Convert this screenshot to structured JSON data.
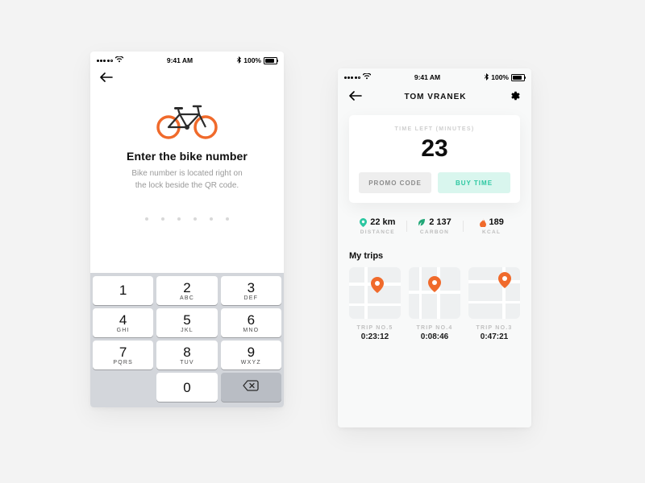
{
  "statusbar": {
    "time": "9:41 AM",
    "battery": "100%"
  },
  "screenA": {
    "title": "Enter the bike number",
    "subtitle_line1": "Bike number is located right on",
    "subtitle_line2": "the lock beside the QR code.",
    "code_length": 6,
    "keypad": {
      "r1": [
        {
          "digit": "1",
          "letters": ""
        },
        {
          "digit": "2",
          "letters": "ABC"
        },
        {
          "digit": "3",
          "letters": "DEF"
        }
      ],
      "r2": [
        {
          "digit": "4",
          "letters": "GHI"
        },
        {
          "digit": "5",
          "letters": "JKL"
        },
        {
          "digit": "6",
          "letters": "MNO"
        }
      ],
      "r3": [
        {
          "digit": "7",
          "letters": "PQRS"
        },
        {
          "digit": "8",
          "letters": "TUV"
        },
        {
          "digit": "9",
          "letters": "WXYZ"
        }
      ],
      "zero": {
        "digit": "0",
        "letters": ""
      }
    }
  },
  "screenB": {
    "username": "TOM VRANEK",
    "time_left_label": "TIME LEFT (MINUTES)",
    "time_left_value": "23",
    "promo_button": "PROMO CODE",
    "buy_button": "BUY TIME",
    "stats": {
      "distance": {
        "value": "22 km",
        "caption": "DISTANCE"
      },
      "carbon": {
        "value": "2 137",
        "caption": "CARBON"
      },
      "kcal": {
        "value": "189",
        "caption": "KCAL"
      }
    },
    "trips_title": "My trips",
    "trips": [
      {
        "label": "TRIP NO.5",
        "time": "0:23:12"
      },
      {
        "label": "TRIP NO.4",
        "time": "0:08:46"
      },
      {
        "label": "TRIP NO.3",
        "time": "0:47:21"
      }
    ]
  }
}
